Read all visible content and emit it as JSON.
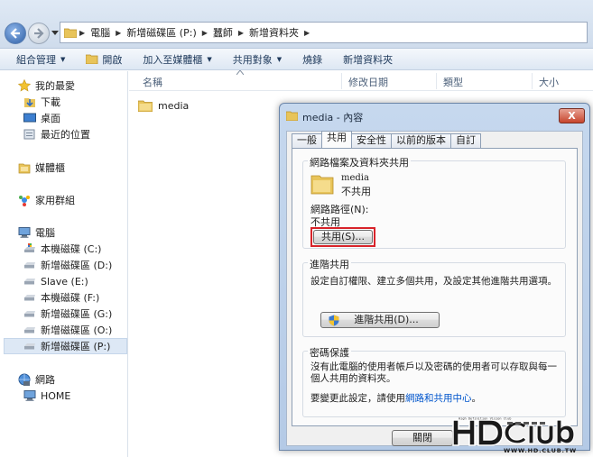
{
  "address_bar": {
    "crumbs": [
      "電腦",
      "新增磁碟區 (P:)",
      "蠶師",
      "新增資料夾"
    ]
  },
  "toolbar": {
    "items": [
      {
        "label": "組合管理",
        "has_menu": true
      },
      {
        "label": "開啟",
        "icon": "folder-open-icon"
      },
      {
        "label": "加入至媒體櫃",
        "has_menu": true
      },
      {
        "label": "共用對象",
        "has_menu": true
      },
      {
        "label": "燒錄"
      },
      {
        "label": "新增資料夾"
      }
    ]
  },
  "sidebar": {
    "favorites": {
      "label": "我的最愛",
      "items": [
        "下載",
        "桌面",
        "最近的位置"
      ]
    },
    "libraries": {
      "label": "媒體櫃"
    },
    "homegroup": {
      "label": "家用群組"
    },
    "computer": {
      "label": "電腦",
      "items": [
        "本機磁碟 (C:)",
        "新增磁碟區 (D:)",
        "Slave (E:)",
        "本機磁碟 (F:)",
        "新增磁碟區 (G:)",
        "新增磁碟區 (O:)",
        "新增磁碟區 (P:)"
      ],
      "selected": "新增磁碟區 (P:)"
    },
    "network": {
      "label": "網路",
      "items": [
        "HOME"
      ]
    }
  },
  "filelist": {
    "columns": [
      "名稱",
      "修改日期",
      "類型",
      "大小"
    ],
    "rows": [
      {
        "name": "media"
      }
    ]
  },
  "dialog": {
    "title": "media - 內容",
    "close_label": "X",
    "tabs": [
      "一般",
      "共用",
      "安全性",
      "以前的版本",
      "自訂"
    ],
    "active_tab": "共用",
    "network_share": {
      "title": "網路檔案及資料夾共用",
      "folder_name": "media",
      "folder_status": "不共用",
      "path_label": "網路路徑(N):",
      "path_value": "不共用",
      "share_button": "共用(S)..."
    },
    "advanced": {
      "title": "進階共用",
      "description": "設定自訂權限、建立多個共用，及設定其他進階共用選項。",
      "button": "進階共用(D)..."
    },
    "password": {
      "title": "密碼保護",
      "description": "沒有此電腦的使用者帳戶以及密碼的使用者可以存取與每一個人共用的資料夾。",
      "change_prefix": "要變更此設定，請使用",
      "link": "網路和共用中心",
      "change_suffix": "。"
    },
    "close_button": "關閉"
  },
  "watermark": {
    "tagline": "High Definition Vision Club",
    "url": "WWW.HD.CLUB.TW"
  },
  "colors": {
    "accent": "#2d5fa6",
    "highlight": "#d8232a",
    "link": "#0055cc",
    "close": "#c7452d"
  }
}
